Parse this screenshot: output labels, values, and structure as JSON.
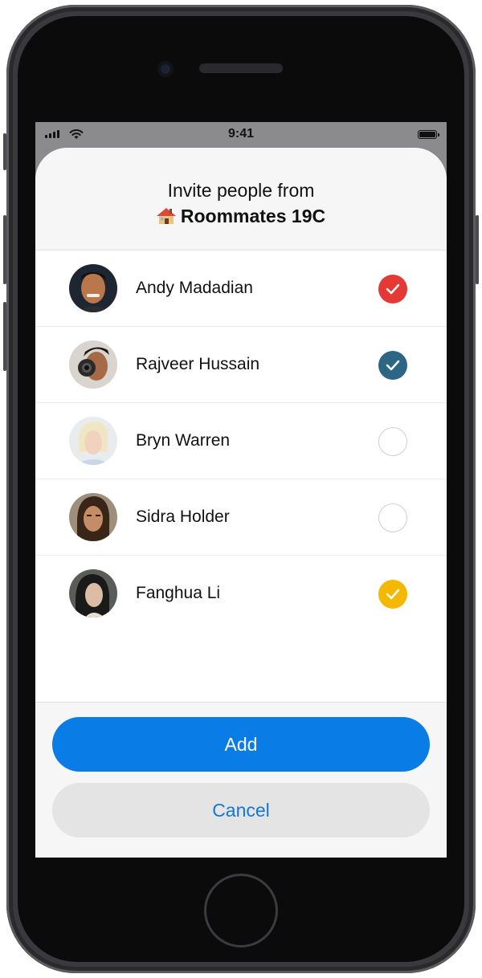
{
  "status_bar": {
    "time": "9:41"
  },
  "sheet": {
    "title": "Invite people from",
    "group_icon": "house-icon",
    "group_name": "Roommates 19C"
  },
  "people": [
    {
      "name": "Andy Madadian",
      "checked": true,
      "check_color": "#e53935"
    },
    {
      "name": "Rajveer Hussain",
      "checked": true,
      "check_color": "#2c6684"
    },
    {
      "name": "Bryn Warren",
      "checked": false
    },
    {
      "name": "Sidra Holder",
      "checked": false
    },
    {
      "name": "Fanghua Li",
      "checked": true,
      "check_color": "#f5b800"
    }
  ],
  "actions": {
    "add_label": "Add",
    "cancel_label": "Cancel"
  },
  "colors": {
    "primary": "#0a7ce6",
    "cancel_text": "#1277d8",
    "cancel_bg": "#e4e4e4"
  }
}
